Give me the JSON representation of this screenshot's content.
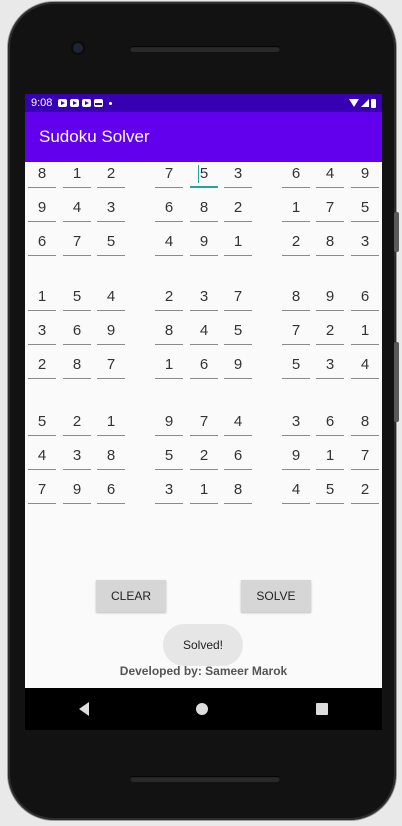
{
  "status_bar": {
    "time": "9:08"
  },
  "app_bar": {
    "title": "Sudoku Solver"
  },
  "board": {
    "rows": [
      [
        "8",
        "1",
        "2",
        "7",
        "5",
        "3",
        "6",
        "4",
        "9"
      ],
      [
        "9",
        "4",
        "3",
        "6",
        "8",
        "2",
        "1",
        "7",
        "5"
      ],
      [
        "6",
        "7",
        "5",
        "4",
        "9",
        "1",
        "2",
        "8",
        "3"
      ],
      [
        "1",
        "5",
        "4",
        "2",
        "3",
        "7",
        "8",
        "9",
        "6"
      ],
      [
        "3",
        "6",
        "9",
        "8",
        "4",
        "5",
        "7",
        "2",
        "1"
      ],
      [
        "2",
        "8",
        "7",
        "1",
        "6",
        "9",
        "5",
        "3",
        "4"
      ],
      [
        "5",
        "2",
        "1",
        "9",
        "7",
        "4",
        "3",
        "6",
        "8"
      ],
      [
        "4",
        "3",
        "8",
        "5",
        "2",
        "6",
        "9",
        "1",
        "7"
      ],
      [
        "7",
        "9",
        "6",
        "3",
        "1",
        "8",
        "4",
        "5",
        "2"
      ]
    ],
    "focused_cell": [
      0,
      4
    ]
  },
  "buttons": {
    "clear_label": "CLEAR",
    "solve_label": "SOLVE"
  },
  "toast": {
    "text": "Solved!"
  },
  "footer": {
    "credit": "Developed by: Sameer Marok"
  },
  "colors": {
    "app_bar": "#6200ee",
    "status_bar": "#3700b3",
    "focus_accent": "#26a69a"
  }
}
